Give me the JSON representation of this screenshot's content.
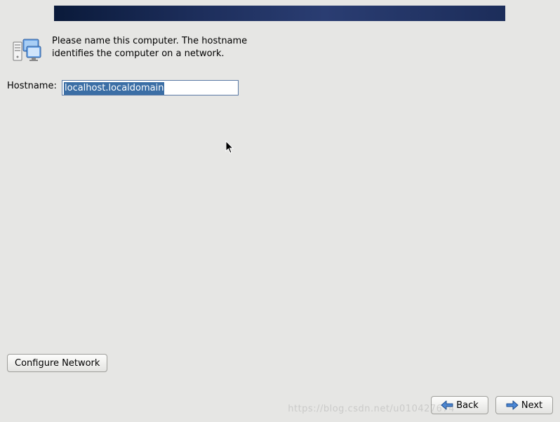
{
  "intro": {
    "text": "Please name this computer.  The hostname identifies the computer on a network."
  },
  "hostname": {
    "label": "Hostname:",
    "value": "localhost.localdomain"
  },
  "buttons": {
    "configure_network": "Configure Network",
    "back": "Back",
    "next": "Next"
  },
  "watermark": "https://blog.csdn.net/u010427674"
}
